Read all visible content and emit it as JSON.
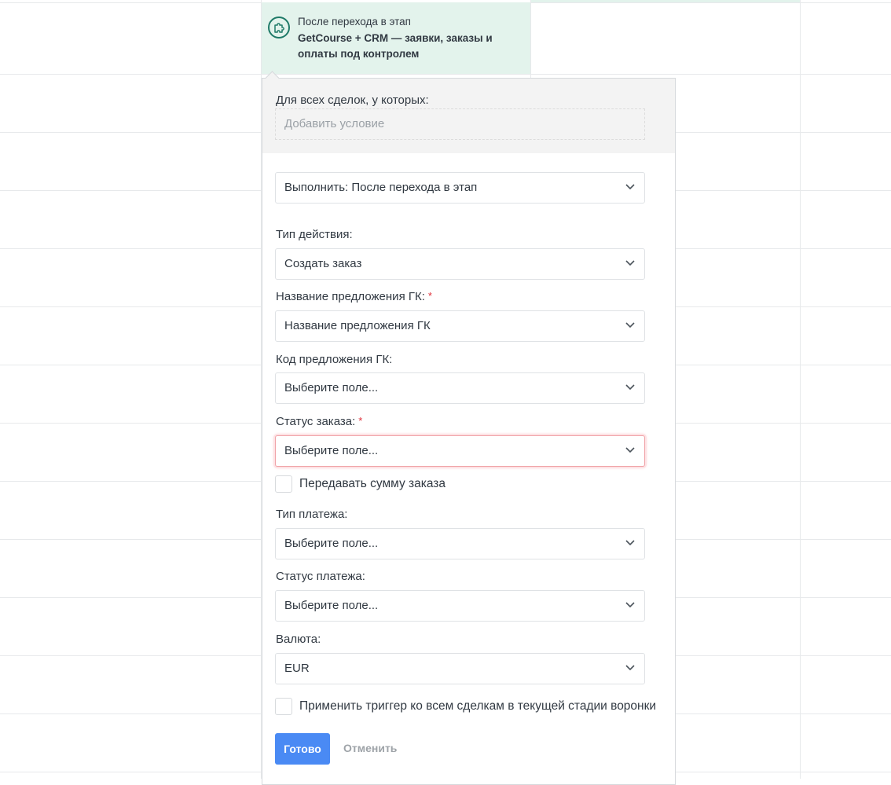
{
  "trigger": {
    "subtitle": "После перехода в этап",
    "title": "GetCourse + CRM — заявки, заказы и оплаты под контролем",
    "icon": "puzzle-icon",
    "accent": "#1f7a68"
  },
  "conditions": {
    "label": "Для всех сделок, у которых:",
    "add_placeholder": "Добавить условие"
  },
  "execute": {
    "value": "Выполнить: После перехода в этап"
  },
  "fields": {
    "action_type": {
      "label": "Тип действия:",
      "value": "Создать заказ"
    },
    "offer_name": {
      "label": "Название предложения ГК:",
      "required": "*",
      "value": "Название предложения ГК"
    },
    "offer_code": {
      "label": "Код предложения ГК:",
      "value": "Выберите поле..."
    },
    "order_status": {
      "label": "Статус заказа:",
      "required": "*",
      "value": "Выберите поле..."
    },
    "pass_amount": {
      "label": "Передавать сумму заказа"
    },
    "payment_type": {
      "label": "Тип платежа:",
      "value": "Выберите поле..."
    },
    "payment_status": {
      "label": "Статус платежа:",
      "value": "Выберите поле..."
    },
    "currency": {
      "label": "Валюта:",
      "value": "EUR"
    },
    "apply_all": {
      "label": "Применить триггер ко всем сделкам в текущей стадии воронки"
    }
  },
  "buttons": {
    "done": "Готово",
    "cancel": "Отменить"
  },
  "colors": {
    "primary": "#4a8af4",
    "error": "#e0303a",
    "trigger_bg": "#e3f3ec"
  }
}
